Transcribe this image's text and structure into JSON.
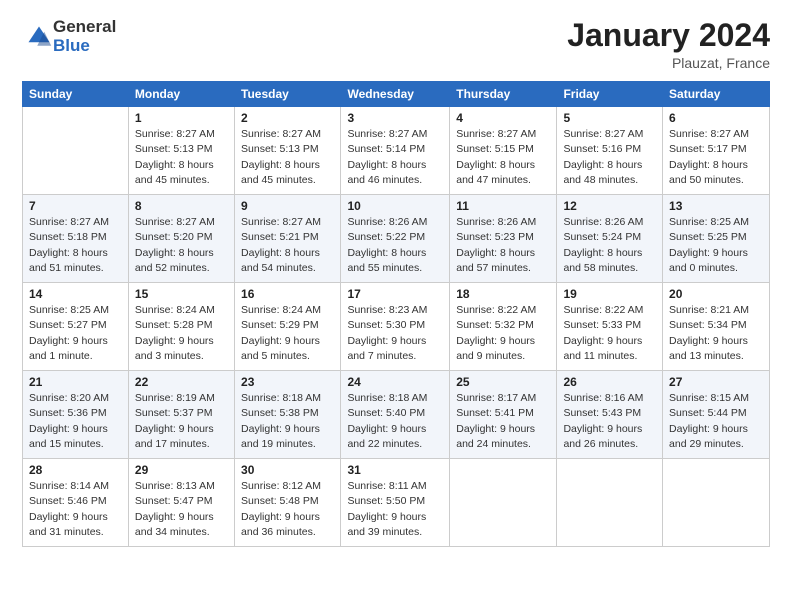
{
  "logo": {
    "general": "General",
    "blue": "Blue"
  },
  "header": {
    "title": "January 2024",
    "location": "Plauzat, France"
  },
  "weekdays": [
    "Sunday",
    "Monday",
    "Tuesday",
    "Wednesday",
    "Thursday",
    "Friday",
    "Saturday"
  ],
  "weeks": [
    [
      {
        "day": "",
        "info": ""
      },
      {
        "day": "1",
        "info": "Sunrise: 8:27 AM\nSunset: 5:13 PM\nDaylight: 8 hours\nand 45 minutes."
      },
      {
        "day": "2",
        "info": "Sunrise: 8:27 AM\nSunset: 5:13 PM\nDaylight: 8 hours\nand 45 minutes."
      },
      {
        "day": "3",
        "info": "Sunrise: 8:27 AM\nSunset: 5:14 PM\nDaylight: 8 hours\nand 46 minutes."
      },
      {
        "day": "4",
        "info": "Sunrise: 8:27 AM\nSunset: 5:15 PM\nDaylight: 8 hours\nand 47 minutes."
      },
      {
        "day": "5",
        "info": "Sunrise: 8:27 AM\nSunset: 5:16 PM\nDaylight: 8 hours\nand 48 minutes."
      },
      {
        "day": "6",
        "info": "Sunrise: 8:27 AM\nSunset: 5:17 PM\nDaylight: 8 hours\nand 50 minutes."
      }
    ],
    [
      {
        "day": "7",
        "info": "Sunrise: 8:27 AM\nSunset: 5:18 PM\nDaylight: 8 hours\nand 51 minutes."
      },
      {
        "day": "8",
        "info": "Sunrise: 8:27 AM\nSunset: 5:20 PM\nDaylight: 8 hours\nand 52 minutes."
      },
      {
        "day": "9",
        "info": "Sunrise: 8:27 AM\nSunset: 5:21 PM\nDaylight: 8 hours\nand 54 minutes."
      },
      {
        "day": "10",
        "info": "Sunrise: 8:26 AM\nSunset: 5:22 PM\nDaylight: 8 hours\nand 55 minutes."
      },
      {
        "day": "11",
        "info": "Sunrise: 8:26 AM\nSunset: 5:23 PM\nDaylight: 8 hours\nand 57 minutes."
      },
      {
        "day": "12",
        "info": "Sunrise: 8:26 AM\nSunset: 5:24 PM\nDaylight: 8 hours\nand 58 minutes."
      },
      {
        "day": "13",
        "info": "Sunrise: 8:25 AM\nSunset: 5:25 PM\nDaylight: 9 hours\nand 0 minutes."
      }
    ],
    [
      {
        "day": "14",
        "info": "Sunrise: 8:25 AM\nSunset: 5:27 PM\nDaylight: 9 hours\nand 1 minute."
      },
      {
        "day": "15",
        "info": "Sunrise: 8:24 AM\nSunset: 5:28 PM\nDaylight: 9 hours\nand 3 minutes."
      },
      {
        "day": "16",
        "info": "Sunrise: 8:24 AM\nSunset: 5:29 PM\nDaylight: 9 hours\nand 5 minutes."
      },
      {
        "day": "17",
        "info": "Sunrise: 8:23 AM\nSunset: 5:30 PM\nDaylight: 9 hours\nand 7 minutes."
      },
      {
        "day": "18",
        "info": "Sunrise: 8:22 AM\nSunset: 5:32 PM\nDaylight: 9 hours\nand 9 minutes."
      },
      {
        "day": "19",
        "info": "Sunrise: 8:22 AM\nSunset: 5:33 PM\nDaylight: 9 hours\nand 11 minutes."
      },
      {
        "day": "20",
        "info": "Sunrise: 8:21 AM\nSunset: 5:34 PM\nDaylight: 9 hours\nand 13 minutes."
      }
    ],
    [
      {
        "day": "21",
        "info": "Sunrise: 8:20 AM\nSunset: 5:36 PM\nDaylight: 9 hours\nand 15 minutes."
      },
      {
        "day": "22",
        "info": "Sunrise: 8:19 AM\nSunset: 5:37 PM\nDaylight: 9 hours\nand 17 minutes."
      },
      {
        "day": "23",
        "info": "Sunrise: 8:18 AM\nSunset: 5:38 PM\nDaylight: 9 hours\nand 19 minutes."
      },
      {
        "day": "24",
        "info": "Sunrise: 8:18 AM\nSunset: 5:40 PM\nDaylight: 9 hours\nand 22 minutes."
      },
      {
        "day": "25",
        "info": "Sunrise: 8:17 AM\nSunset: 5:41 PM\nDaylight: 9 hours\nand 24 minutes."
      },
      {
        "day": "26",
        "info": "Sunrise: 8:16 AM\nSunset: 5:43 PM\nDaylight: 9 hours\nand 26 minutes."
      },
      {
        "day": "27",
        "info": "Sunrise: 8:15 AM\nSunset: 5:44 PM\nDaylight: 9 hours\nand 29 minutes."
      }
    ],
    [
      {
        "day": "28",
        "info": "Sunrise: 8:14 AM\nSunset: 5:46 PM\nDaylight: 9 hours\nand 31 minutes."
      },
      {
        "day": "29",
        "info": "Sunrise: 8:13 AM\nSunset: 5:47 PM\nDaylight: 9 hours\nand 34 minutes."
      },
      {
        "day": "30",
        "info": "Sunrise: 8:12 AM\nSunset: 5:48 PM\nDaylight: 9 hours\nand 36 minutes."
      },
      {
        "day": "31",
        "info": "Sunrise: 8:11 AM\nSunset: 5:50 PM\nDaylight: 9 hours\nand 39 minutes."
      },
      {
        "day": "",
        "info": ""
      },
      {
        "day": "",
        "info": ""
      },
      {
        "day": "",
        "info": ""
      }
    ]
  ]
}
